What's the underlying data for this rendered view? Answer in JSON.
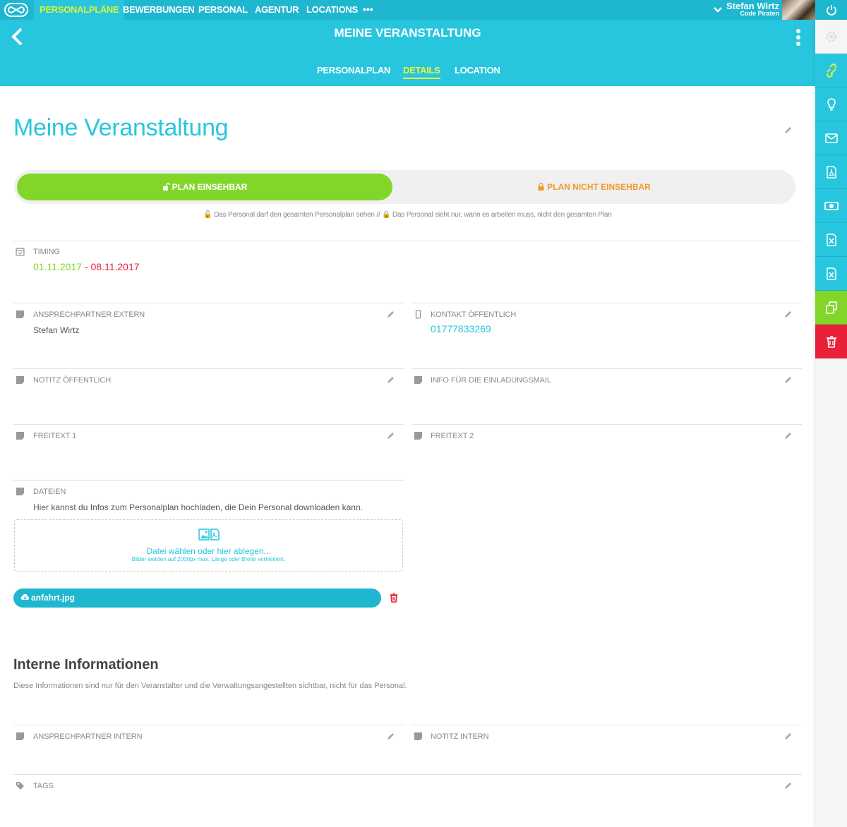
{
  "topnav": {
    "items": [
      "PERSONALPLÄNE",
      "BEWERBUNGEN",
      "PERSONAL",
      "AGENTUR",
      "LOCATIONS"
    ],
    "more": "•••",
    "user_name": "Stefan Wirtz",
    "user_company": "Code Piraten"
  },
  "header": {
    "title": "MEINE VERANSTALTUNG",
    "tabs": [
      "PERSONALPLAN",
      "DETAILS",
      "LOCATION"
    ],
    "active_tab": "DETAILS"
  },
  "event": {
    "title": "Meine Veranstaltung",
    "toggle_on": "PLAN EINSEHBAR",
    "toggle_off": "PLAN NICHT EINSEHBAR",
    "hint_visible": "Das Personal darf den gesamten Personalplan sehen //",
    "hint_hidden": "Das Personal sieht nur, wann es arbeiten muss, nicht den gesamten Plan"
  },
  "timing": {
    "label": "TIMING",
    "start": "01.11.2017",
    "separator": " - ",
    "end": "08.11.2017"
  },
  "fields": {
    "contact_external_label": "ANSPRECHPARTNER EXTERN",
    "contact_external_value": "Stefan Wirtz",
    "contact_public_label": "KONTAKT ÖFFENTLICH",
    "contact_public_value": "01777833269",
    "note_public_label": "NOTITZ ÖFFENTLICH",
    "invite_info_label": "INFO FÜR DIE EINLADUNGSMAIL",
    "freetext1_label": "FREITEXT 1",
    "freetext2_label": "FREITEXT 2"
  },
  "files": {
    "label": "DATEIEN",
    "description": "Hier kannst du Infos zum Personalplan hochladen, die Dein Personal downloaden kann.",
    "upload_main": "Datei wählen oder hier ablegen...",
    "upload_sub": "Bilder werden auf 2000px max. Länge oder Breite verkleinert.",
    "file_name": "anfahrt.jpg"
  },
  "internal": {
    "title": "Interne Informationen",
    "description": "Diese Informationen sind nur für den Veranstalter und die Verwaltungsangestellten sichtbar, nicht für das Personal.",
    "contact_internal_label": "ANSPRECHPARTNER INTERN",
    "note_internal_label": "NOTITZ INTERN",
    "tags_label": "TAGS"
  },
  "sidebar": {
    "icons": [
      "gear-icon",
      "link-icon",
      "lightbulb-icon",
      "mail-icon",
      "pdf-icon",
      "money-icon",
      "excel-icon",
      "excel-icon",
      "copy-icon",
      "trash-icon"
    ],
    "colors": {
      "default": "#27c6de",
      "copy": "#82d62a",
      "delete": "#e8203a"
    }
  },
  "colors": {
    "accent": "#27c6de",
    "green": "#82d62a",
    "orange": "#f19a2c",
    "red": "#e8203a"
  }
}
